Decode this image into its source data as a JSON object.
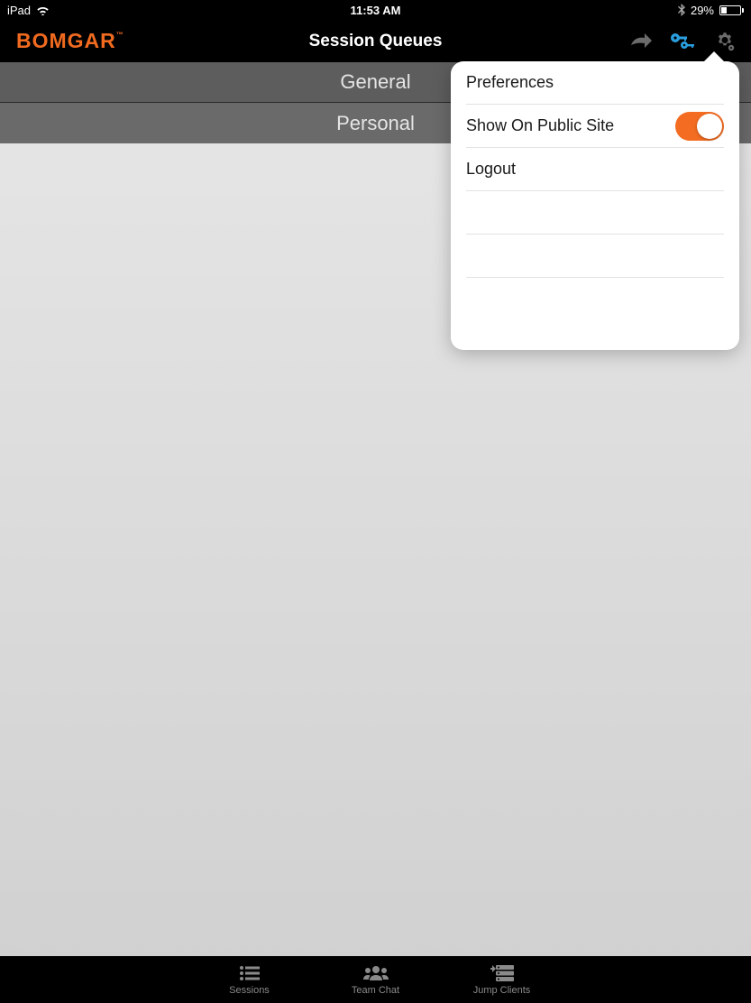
{
  "statusbar": {
    "device": "iPad",
    "time": "11:53 AM",
    "battery_percent": "29%"
  },
  "navbar": {
    "logo": "BOMGAR",
    "title": "Session Queues"
  },
  "queues": {
    "general": "General",
    "personal": "Personal"
  },
  "popover": {
    "preferences": "Preferences",
    "show_public": "Show On Public Site",
    "show_public_on": true,
    "logout": "Logout"
  },
  "tabbar": {
    "sessions": "Sessions",
    "team_chat": "Team Chat",
    "jump_clients": "Jump Clients"
  },
  "colors": {
    "accent": "#f06a1f",
    "toggle": "#f36c21",
    "key_icon": "#1e8fd6"
  }
}
